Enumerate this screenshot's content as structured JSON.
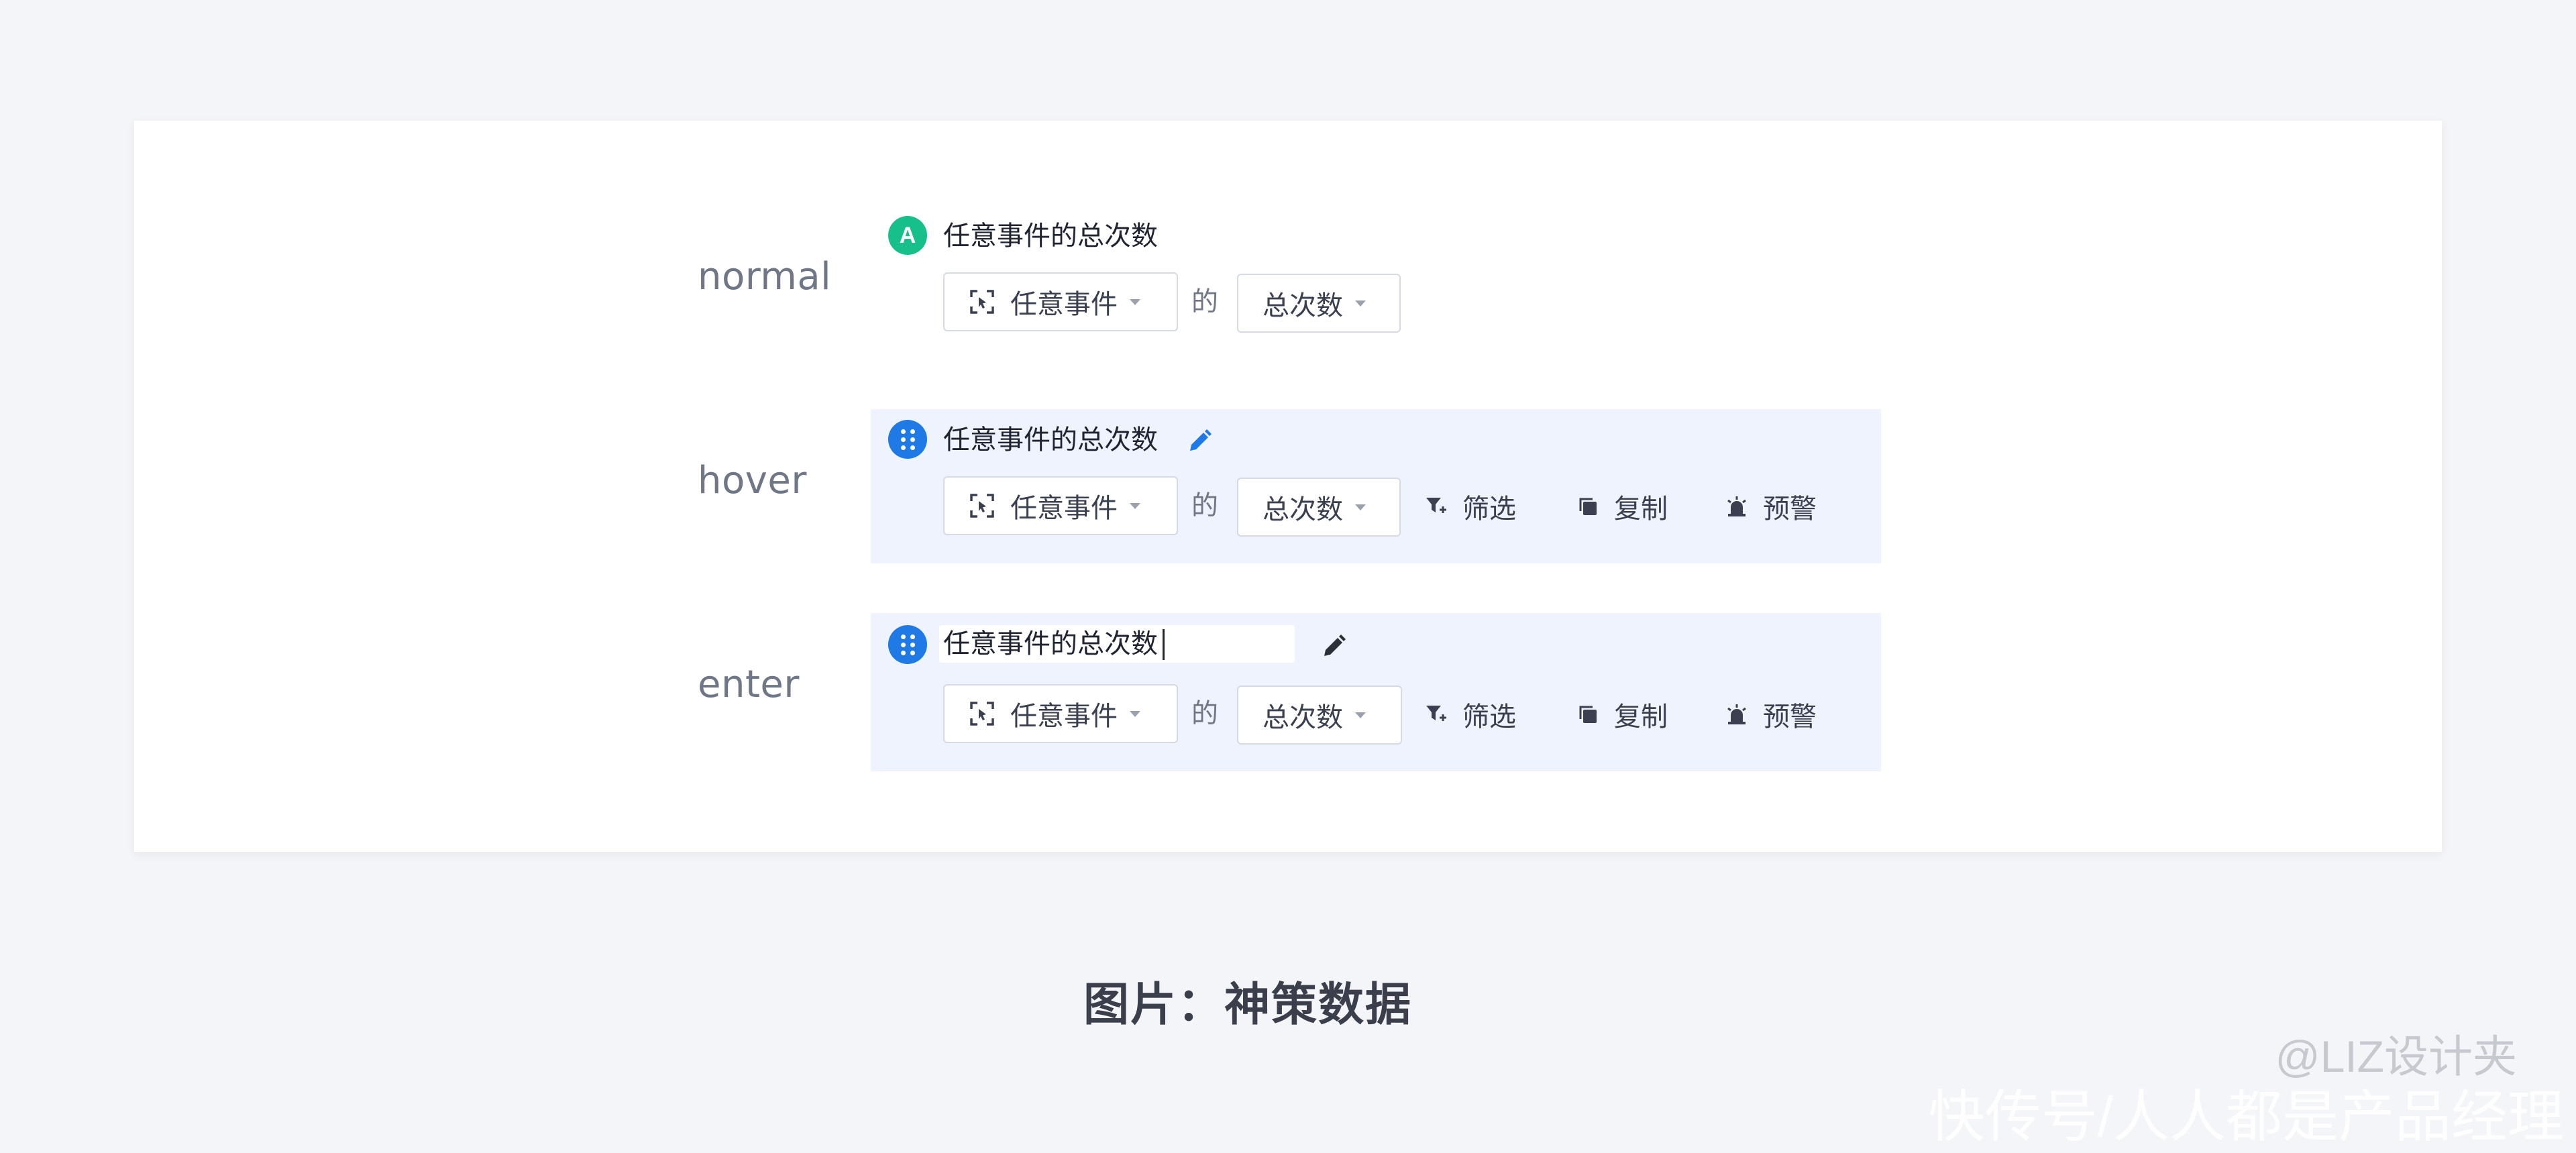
{
  "states": {
    "normal": "normal",
    "hover": "hover",
    "enter": "enter"
  },
  "metric": {
    "badge_letter": "A",
    "title": "任意事件的总次数",
    "event_select": "任意事件",
    "of_text": "的",
    "measure_select": "总次数"
  },
  "actions": {
    "filter": "筛选",
    "copy": "复制",
    "alert": "预警"
  },
  "icons": {
    "event": "scan-event-icon",
    "edit": "pencil-icon",
    "drag": "drag-handle-icon",
    "filter": "filter-plus-icon",
    "copy": "copy-icon",
    "alert": "alarm-icon",
    "dropdown": "caret-down-icon"
  },
  "colors": {
    "badge_green": "#17c08b",
    "badge_blue": "#1f7ae6",
    "highlight_bg": "#eef3fd"
  },
  "caption": "图片：神策数据",
  "watermark": {
    "line1": "@LIZ设计夹",
    "line2": "快传号/人人都是产品经理"
  }
}
